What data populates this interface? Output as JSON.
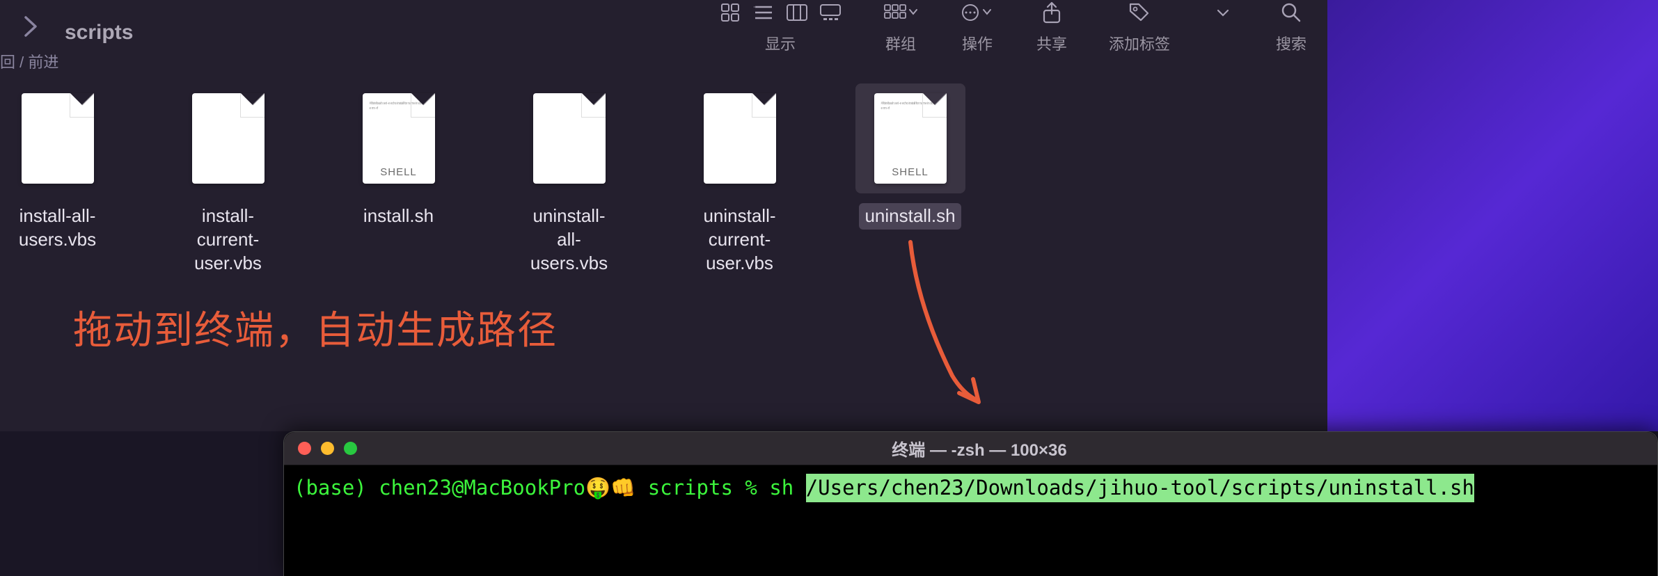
{
  "finder": {
    "folder_title": "scripts",
    "nav_sub": "回 / 前进",
    "toolbar_labels": {
      "view": "显示",
      "group": "群组",
      "action": "操作",
      "share": "共享",
      "tags": "添加标签",
      "search": "搜索"
    },
    "files": [
      {
        "name": "install-all-users.vbs",
        "type": "plain",
        "selected": false
      },
      {
        "name": "install-current-user.vbs",
        "type": "plain",
        "selected": false
      },
      {
        "name": "install.sh",
        "type": "shell",
        "selected": false
      },
      {
        "name": "uninstall-all-users.vbs",
        "type": "plain",
        "selected": false
      },
      {
        "name": "uninstall-current-user.vbs",
        "type": "plain",
        "selected": false
      },
      {
        "name": "uninstall.sh",
        "type": "shell",
        "selected": true
      }
    ],
    "shell_tag": "SHELL"
  },
  "annotation_text": "拖动到终端，自动生成路径",
  "terminal": {
    "title": "终端 — -zsh — 100×36",
    "prompt_prefix": "(base) chen23@MacBookPro",
    "emoji": "🤑👊",
    "prompt_folder": " scripts % ",
    "command": "sh ",
    "selected_path": "/Users/chen23/Downloads/jihuo-tool/scripts/uninstall.sh"
  }
}
